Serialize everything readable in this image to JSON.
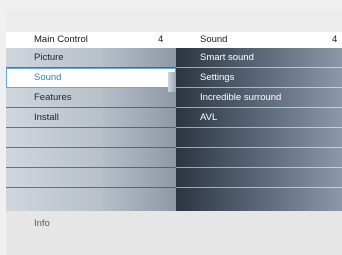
{
  "left_menu": {
    "title": "Main Control",
    "count": "4",
    "items": [
      {
        "label": "Picture"
      },
      {
        "label": "Sound"
      },
      {
        "label": "Features"
      },
      {
        "label": "Install"
      },
      {
        "label": ""
      },
      {
        "label": ""
      },
      {
        "label": ""
      },
      {
        "label": ""
      }
    ],
    "selected_index": 1
  },
  "right_menu": {
    "title": "Sound",
    "count": "4",
    "items": [
      {
        "label": "Smart sound"
      },
      {
        "label": "Settings"
      },
      {
        "label": "Incredible surround"
      },
      {
        "label": "AVL"
      },
      {
        "label": ""
      },
      {
        "label": ""
      },
      {
        "label": ""
      },
      {
        "label": ""
      }
    ]
  },
  "info": {
    "label": "Info"
  },
  "colors": {
    "selection_text": "#2d7fc1",
    "selection_border": "#6aa9d6"
  }
}
